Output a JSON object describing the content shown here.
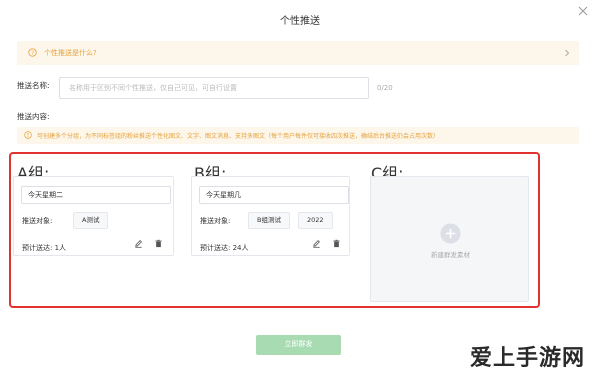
{
  "dialog": {
    "title": "个性推送"
  },
  "faq": {
    "text": "个性推送是什么?"
  },
  "push_name": {
    "label": "推送名称:",
    "placeholder": "名称用于区别不同个性推送，仅自己可见，可自行设置",
    "count": "0/20"
  },
  "push_content": {
    "label": "推送内容:"
  },
  "warning": {
    "text": "可创建多个分组，为不同标签组的粉丝推送个性化图文、文字、图文消息、支持多图文（每个用户每件仅可接收四次推送，确结后台推送仍会占用次数）"
  },
  "groups": [
    {
      "title": "A组:",
      "post_title": "今天星期二",
      "target_label": "推送对象:",
      "tags": [
        "A测试"
      ],
      "estimate": "预计送达: 1人"
    },
    {
      "title": "B组:",
      "post_title": "今天星期几",
      "target_label": "推送对象:",
      "tags": [
        "B组测试",
        "2022"
      ],
      "estimate": "预计送达: 24人"
    },
    {
      "title": "C组:",
      "new_label": "新建群发素材"
    }
  ],
  "actions": {
    "send_label": "立即群发"
  },
  "watermark": "爱上手游网",
  "colors": {
    "accent_warning": "#e6a23c",
    "highlight_frame": "#e0322f",
    "primary_disabled": "#a9dbb3"
  }
}
